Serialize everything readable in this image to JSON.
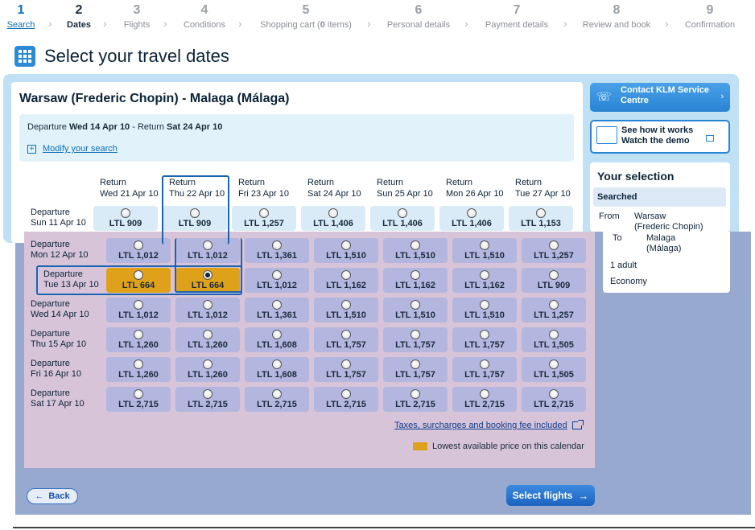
{
  "steps": [
    {
      "num": "1",
      "label": "Search",
      "state": "done"
    },
    {
      "num": "2",
      "label": "Dates",
      "state": "active"
    },
    {
      "num": "3",
      "label": "Flights",
      "state": "todo"
    },
    {
      "num": "4",
      "label": "Conditions",
      "state": "todo"
    },
    {
      "num": "5",
      "label_pre": "Shopping cart (",
      "label_count": "0",
      "label_post": " items)",
      "state": "todo"
    },
    {
      "num": "6",
      "label": "Personal details",
      "state": "todo"
    },
    {
      "num": "7",
      "label": "Payment details",
      "state": "todo"
    },
    {
      "num": "8",
      "label": "Review and book",
      "state": "todo"
    },
    {
      "num": "9",
      "label": "Confirmation",
      "state": "todo"
    }
  ],
  "page_title": "Select your travel dates",
  "route": "Warsaw (Frederic Chopin) - Malaga (Málaga)",
  "search_summary": {
    "dep_label": "Departure ",
    "dep_value": "Wed 14 Apr 10",
    "ret_label": " - Return ",
    "ret_value": "Sat 24 Apr 10"
  },
  "modify_label": "Modify your search",
  "grid": {
    "return_word": "Return",
    "departure_word": "Departure",
    "currency": "LTL",
    "return_dates": [
      "Wed 21 Apr 10",
      "Thu 22 Apr 10",
      "Fri 23 Apr 10",
      "Sat 24 Apr 10",
      "Sun 25 Apr 10",
      "Mon 26 Apr 10",
      "Tue 27 Apr 10"
    ],
    "departure_dates": [
      "Sun 11 Apr 10",
      "Mon 12 Apr 10",
      "Tue 13 Apr 10",
      "Wed 14 Apr 10",
      "Thu 15 Apr 10",
      "Fri 16 Apr 10",
      "Sat 17 Apr 10"
    ],
    "prices": [
      [
        "909",
        "909",
        "1,257",
        "1,406",
        "1,406",
        "1,406",
        "1,153"
      ],
      [
        "1,012",
        "1,012",
        "1,361",
        "1,510",
        "1,510",
        "1,510",
        "1,257"
      ],
      [
        "664",
        "664",
        "1,012",
        "1,162",
        "1,162",
        "1,162",
        "909"
      ],
      [
        "1,012",
        "1,012",
        "1,361",
        "1,510",
        "1,510",
        "1,510",
        "1,257"
      ],
      [
        "1,260",
        "1,260",
        "1,608",
        "1,757",
        "1,757",
        "1,757",
        "1,505"
      ],
      [
        "1,260",
        "1,260",
        "1,608",
        "1,757",
        "1,757",
        "1,757",
        "1,505"
      ],
      [
        "2,715",
        "2,715",
        "2,715",
        "2,715",
        "2,715",
        "2,715",
        "2,715"
      ]
    ],
    "lowest_cells": [
      [
        2,
        0
      ],
      [
        2,
        1
      ]
    ],
    "selected_cell": [
      2,
      1
    ],
    "highlighted_column": 1,
    "highlighted_row": 2
  },
  "taxes_link": "Taxes, surcharges and booking fee included",
  "legend_label": "Lowest available price on this calendar",
  "back_label": "Back",
  "select_flights_label": "Select flights",
  "contact_label_1": "Contact KLM Service",
  "contact_label_2": "Centre",
  "demo_label_1": "See how it works",
  "demo_label_2": "Watch the demo",
  "selection": {
    "title": "Your selection",
    "searched": "Searched",
    "from_label": "From",
    "from_value_1": "Warsaw",
    "from_value_2": "(Frederic Chopin)",
    "to_label": "To",
    "to_value_1": "Malaga",
    "to_value_2": "(Málaga)",
    "passengers": "1 adult",
    "cabin": "Economy"
  },
  "colors": {
    "accent_blue": "#2a84d4",
    "lowest_price": "#dfa11a",
    "selection_outline": "#1a64b4"
  }
}
